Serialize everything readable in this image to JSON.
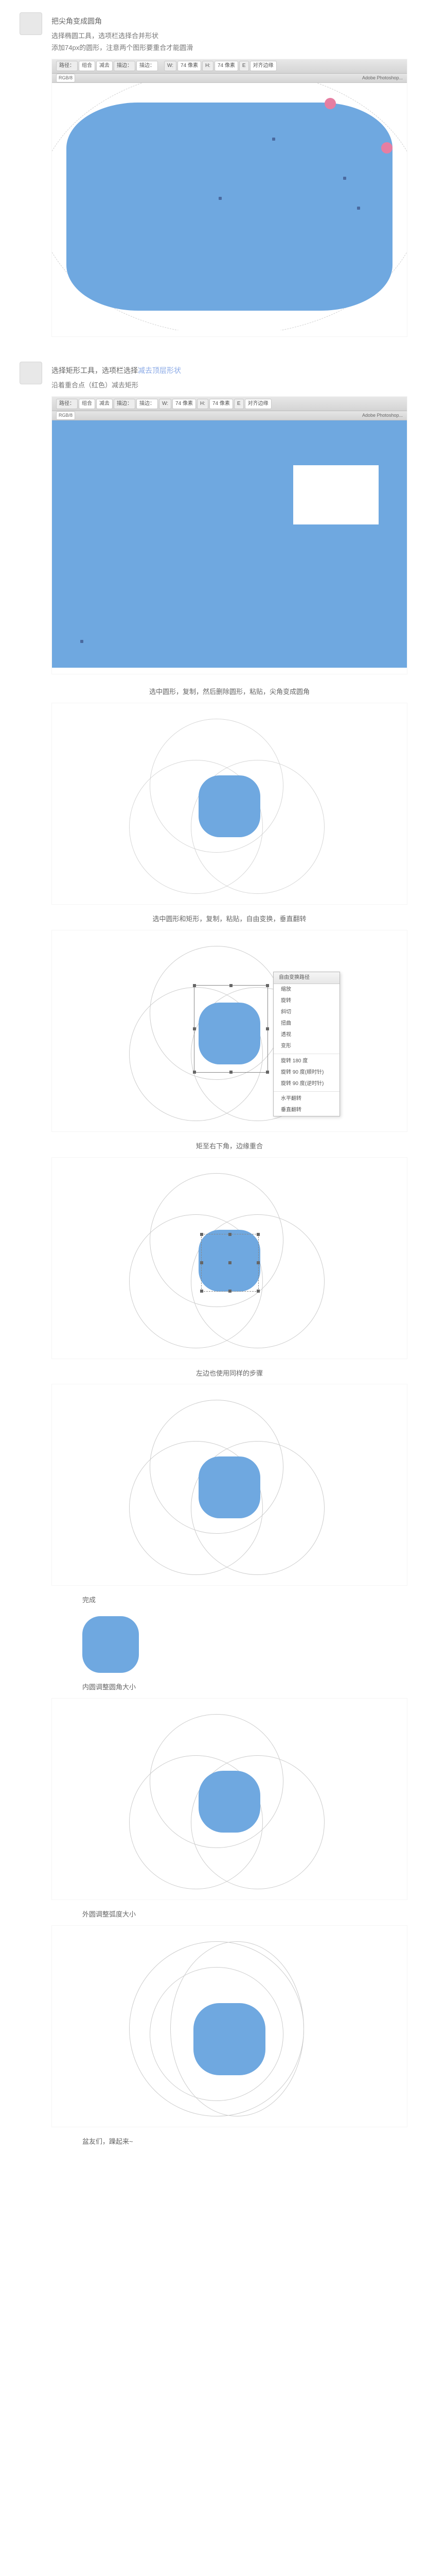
{
  "steps": {
    "s1": {
      "title": "把尖角变成圆角",
      "line1": "选择椭圆工具，选项栏选择合并形状",
      "line2": "添加74px的圆形，注意两个图形要重合才能圆滑"
    },
    "s2": {
      "prefix": "选择矩形工具，选项栏选择",
      "link": "减去顶层形状",
      "line": "沿着重合点（红色）减去矩形"
    }
  },
  "ps": {
    "a": "路径：",
    "b": "组合",
    "c": "减去",
    "d": "描边：",
    "e": "描边：",
    "f": "W:",
    "g": "74 像素",
    "h": "H:",
    "i": "74 像素",
    "j": "E",
    "k": "对齐边缘",
    "psTitle": "Adobe Photoshop...",
    "docMeta": "RGB/8"
  },
  "caps": {
    "c3": "选中圆形，复制，然后删除圆形，粘贴，尖角变成圆角",
    "c4": "选中圆形和矩形，复制，粘贴，自由变换，垂直翻转",
    "c5": "矩至右下角，边缘重合",
    "c6": "左边也使用同样的步骤",
    "c7": "完成",
    "c8": "内圆调整圆角大小",
    "c9": "外圆调整弧度大小",
    "end": "盆友们，躁起来~"
  },
  "menu": {
    "head": "自由变换路径",
    "a": "缩放",
    "b": "旋转",
    "c": "斜切",
    "d": "扭曲",
    "e": "透视",
    "f": "变形",
    "g": "旋转 180 度",
    "h": "旋转 90 度(顺时针)",
    "i": "旋转 90 度(逆时针)",
    "j": "水平翻转",
    "k": "垂直翻转"
  }
}
